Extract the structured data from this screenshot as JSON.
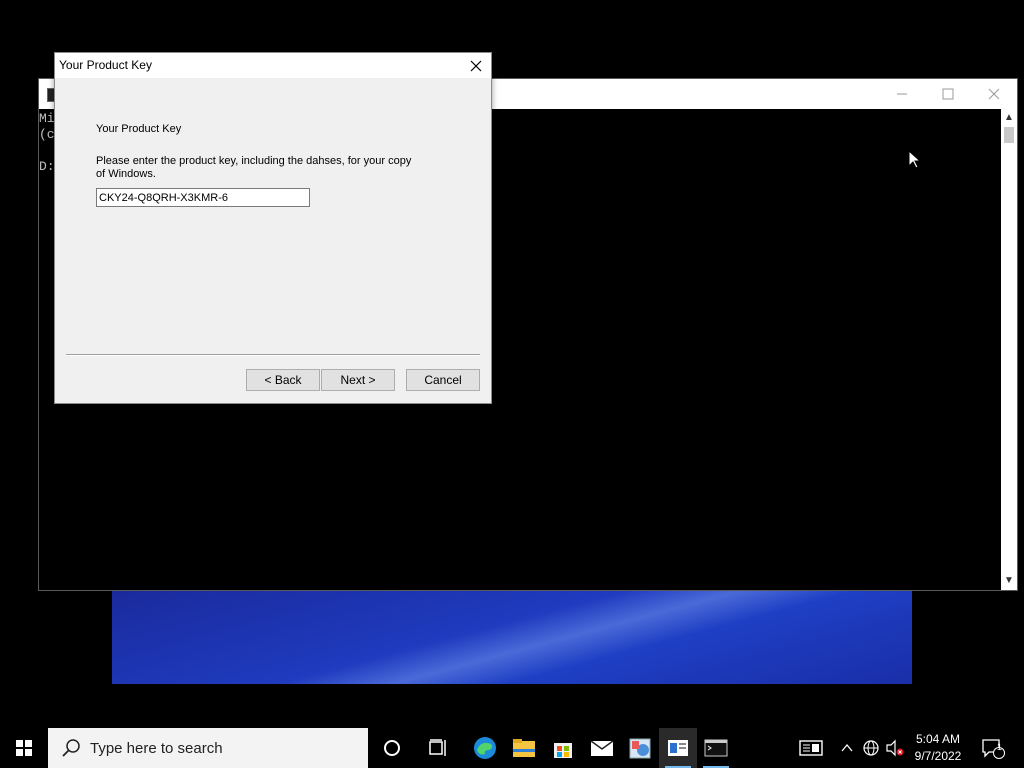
{
  "console": {
    "lines": [
      "Mi",
      "(c",
      "",
      "D:"
    ]
  },
  "dialog": {
    "title": "Your Product Key",
    "heading": "Your Product Key",
    "description": "Please enter the product key, including the dahses, for your copy of Windows.",
    "product_key_value": "CKY24-Q8QRH-X3KMR-6",
    "buttons": {
      "back": "< Back",
      "next": "Next >",
      "cancel": "Cancel"
    }
  },
  "taskbar": {
    "search_placeholder": "Type here to search",
    "icons": [
      "windows-start-icon",
      "cortana-circle-icon",
      "task-view-icon",
      "edge-icon",
      "file-explorer-icon",
      "store-icon",
      "mail-icon",
      "app-icon",
      "active-app-icon",
      "terminal-icon"
    ],
    "clock": {
      "time": "5:04 AM",
      "date": "9/7/2022"
    },
    "notification_count": "1"
  },
  "colors": {
    "taskbar_bg": "#000000",
    "dialog_bg": "#f0f0f0",
    "accent": "#76b9ed",
    "wallpaper": "#1f3bbf"
  }
}
